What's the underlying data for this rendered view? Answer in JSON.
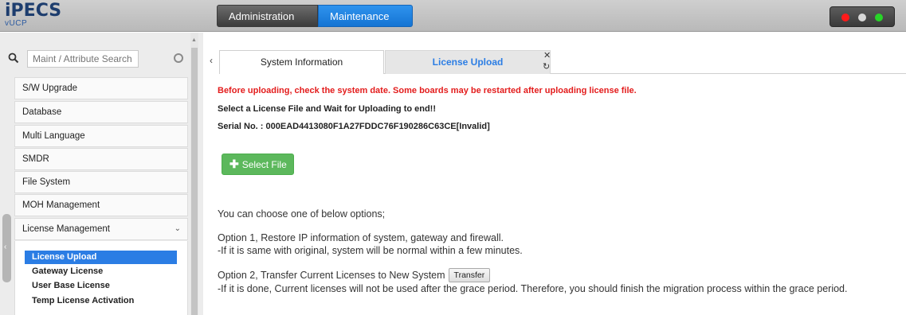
{
  "header": {
    "logo": "iPECS",
    "product": "vUCP",
    "tabs": [
      {
        "label": "Administration"
      },
      {
        "label": "Maintenance"
      }
    ]
  },
  "sidebar": {
    "search_placeholder": "Maint / Attribute Search",
    "items": [
      {
        "label": "S/W Upgrade"
      },
      {
        "label": "Database"
      },
      {
        "label": "Multi Language"
      },
      {
        "label": "SMDR"
      },
      {
        "label": "File System"
      },
      {
        "label": "MOH Management"
      },
      {
        "label": "License Management"
      }
    ],
    "subitems": [
      {
        "label": "License Upload"
      },
      {
        "label": "Gateway License"
      },
      {
        "label": "User Base License"
      },
      {
        "label": "Temp License Activation"
      }
    ]
  },
  "main": {
    "tabs": [
      {
        "label": "System Information"
      },
      {
        "label": "License Upload"
      }
    ],
    "warning": "Before uploading, check the system date. Some boards may be restarted after uploading license file.",
    "instruction": "Select a License File and Wait for Uploading to end!!",
    "serial": "Serial No. : 000EAD4413080F1A27FDDC76F190286C63CE[Invalid]",
    "select_file_label": "Select File",
    "options_intro": "You can choose one of below options;",
    "option1_title": "Option 1, Restore IP information of system, gateway and firewall.",
    "option1_desc": "-If it is same with original, system will be normal within a few minutes.",
    "option2_title": "Option 2, Transfer Current Licenses to New System",
    "transfer_label": "Transfer",
    "option2_desc": "-If it is done, Current licenses will not be used after the grace period. Therefore, you should finish the migration process within the grace period."
  },
  "colors": {
    "accent": "#1574d3",
    "warning": "#e31c1c",
    "select_button": "#5cb85c"
  }
}
